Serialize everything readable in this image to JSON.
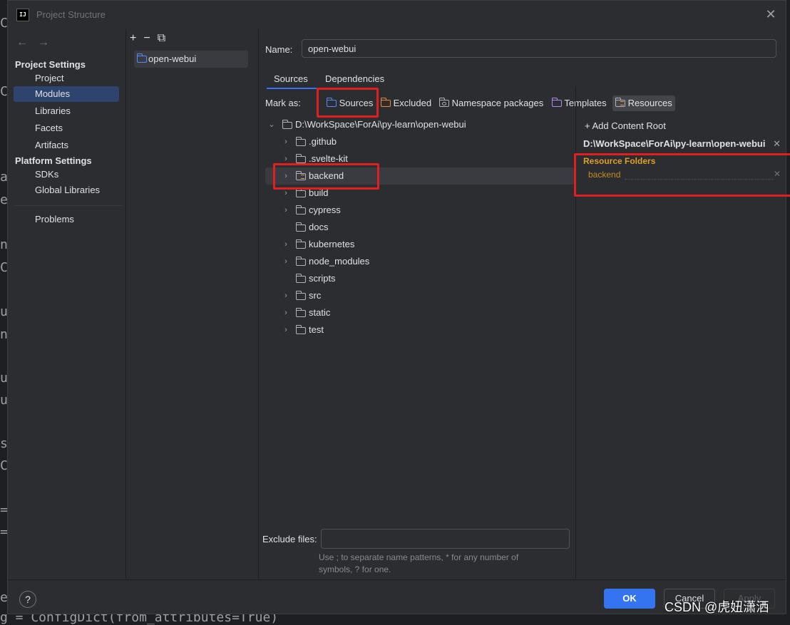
{
  "window": {
    "title": "Project Structure",
    "app_icon_text": "IJ"
  },
  "background_fragments": [
    "Co",
    "Co",
    "as",
    "e_",
    "n(",
    "Co",
    "un",
    "n",
    "un",
    "un",
    "s",
    "C",
    "=",
    "=",
    "el",
    "g = ConfigDict(from_attributes=True)"
  ],
  "nav": {
    "back_icon": "arrow-left-icon",
    "forward_icon": "arrow-right-icon",
    "project_settings_header": "Project Settings",
    "project_settings_items": [
      "Project",
      "Modules",
      "Libraries",
      "Facets",
      "Artifacts"
    ],
    "selected_item": "Modules",
    "platform_settings_header": "Platform Settings",
    "platform_settings_items": [
      "SDKs",
      "Global Libraries"
    ],
    "problems": "Problems"
  },
  "modules": {
    "tools": [
      "add-icon",
      "remove-icon",
      "copy-icon"
    ],
    "items": [
      "open-webui"
    ]
  },
  "module_settings": {
    "name_label": "Name:",
    "name_value": "open-webui",
    "tabs": [
      "Sources",
      "Dependencies"
    ],
    "active_tab": "Sources",
    "mark_as_label": "Mark as:",
    "mark_as_options": [
      "Sources",
      "Excluded",
      "Namespace packages",
      "Templates",
      "Resources"
    ],
    "mark_as_active": "Resources",
    "tree": {
      "root": "D:\\WorkSpace\\ForAi\\py-learn\\open-webui",
      "children": [
        {
          "label": ".github",
          "expandable": true,
          "type": "normal"
        },
        {
          "label": ".svelte-kit",
          "expandable": true,
          "type": "normal"
        },
        {
          "label": "backend",
          "expandable": true,
          "type": "resource",
          "selected": true
        },
        {
          "label": "build",
          "expandable": true,
          "type": "normal"
        },
        {
          "label": "cypress",
          "expandable": true,
          "type": "normal"
        },
        {
          "label": "docs",
          "expandable": false,
          "type": "normal"
        },
        {
          "label": "kubernetes",
          "expandable": true,
          "type": "normal"
        },
        {
          "label": "node_modules",
          "expandable": true,
          "type": "normal"
        },
        {
          "label": "scripts",
          "expandable": false,
          "type": "normal"
        },
        {
          "label": "src",
          "expandable": true,
          "type": "normal"
        },
        {
          "label": "static",
          "expandable": true,
          "type": "normal"
        },
        {
          "label": "test",
          "expandable": true,
          "type": "normal"
        }
      ]
    },
    "exclude_files_label": "Exclude files:",
    "exclude_files_value": "",
    "exclude_hint": "Use ; to separate name patterns, * for any number of symbols, ? for one."
  },
  "content_root": {
    "add_label": "Add Content Root",
    "root_path": "D:\\WorkSpace\\ForAi\\py-learn\\open-webui",
    "resource_folders_header": "Resource Folders",
    "resource_folders": [
      "backend"
    ]
  },
  "buttons": {
    "help": "?",
    "ok": "OK",
    "cancel": "Cancel",
    "apply": "Apply"
  },
  "watermark": "CSDN @虎妞潇洒",
  "colors": {
    "accent": "#3574f0",
    "selection": "#2e436e",
    "resource": "#e0a020",
    "highlight_box": "#e02020"
  }
}
